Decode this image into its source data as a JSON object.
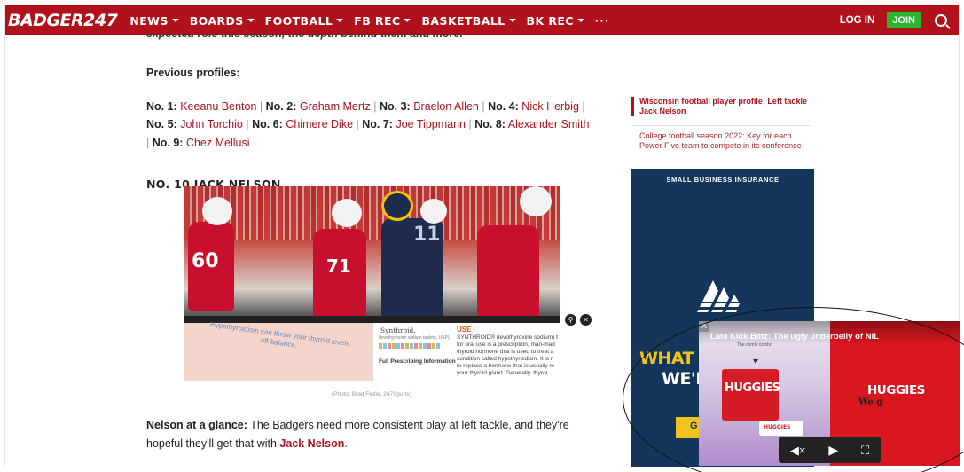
{
  "nav": {
    "logo": "BADGER247",
    "items": [
      "NEWS",
      "BOARDS",
      "FOOTBALL",
      "FB REC",
      "BASKETBALL",
      "BK REC"
    ],
    "more": "···",
    "login": "LOG IN",
    "join": "JOIN"
  },
  "article": {
    "cut_line": "expected role this season, the depth behind them and more.",
    "previous_label": "Previous profiles:",
    "profiles": [
      {
        "num": "No. 1:",
        "name": "Keeanu Benton"
      },
      {
        "num": "No. 2:",
        "name": "Graham Mertz"
      },
      {
        "num": "No. 3:",
        "name": "Braelon Allen"
      },
      {
        "num": "No. 4:",
        "name": "Nick Herbig"
      },
      {
        "num": "No. 5:",
        "name": "John Torchio"
      },
      {
        "num": "No. 6:",
        "name": "Chimere Dike"
      },
      {
        "num": "No. 7:",
        "name": "Joe Tippmann"
      },
      {
        "num": "No. 8:",
        "name": "Alexander Smith"
      },
      {
        "num": "No. 9:",
        "name": "Chez Mellusi"
      }
    ],
    "section_heading": "NO. 10 JACK NELSON",
    "photo_credit": "(Photo: Brad Fedie, 247Sports)",
    "glance_label": "Nelson at a glance:",
    "glance_text": " The Badgers need more consistent play at left tackle, and they're hopeful they'll get that with ",
    "glance_link": "Jack Nelson",
    "glance_end": "."
  },
  "inline_ad": {
    "left_text": "Hypothyroidism can throw your thyroid levels off-balance.",
    "brand": "Synthroid.",
    "brand_sub": "(levothyroxine sodium tablets, USP)",
    "fpi": "Full Prescribing Information",
    "use_title": "USE",
    "use_body": "SYNTHROID® (levothyroxine sodium) t for oral use is a prescription, man-mad thyroid hormone that is used to treat a condition called hypothyroidism. It is n to replace a hormone that is usually m your thyroid gland. Generally, thyroi"
  },
  "sidebar": {
    "link1": "Wisconsin football player profile: Left tackle Jack Nelson",
    "link2": "College football season 2022: Key for each Power Five team to compete in its conference",
    "ad_header": "SMALL BUSINESS INSURANCE",
    "ad_line1": "WHAT YO",
    "ad_line2": "WE'R",
    "ad_button": "G"
  },
  "video_pip": {
    "title": "Late Kick Blitz: The ugly underbelly of NIL",
    "close": "X",
    "subtext": "The comfy combo",
    "box_brand": "HUGGIES",
    "box2_brand": "HUGGIES",
    "right_brand": "HUGGIES",
    "right_sub": "We g"
  },
  "colors": {
    "nav_bg": "#b0111b",
    "link": "#a8141e",
    "join": "#2bb62b",
    "sidebar_ad_bg": "#13365a"
  }
}
